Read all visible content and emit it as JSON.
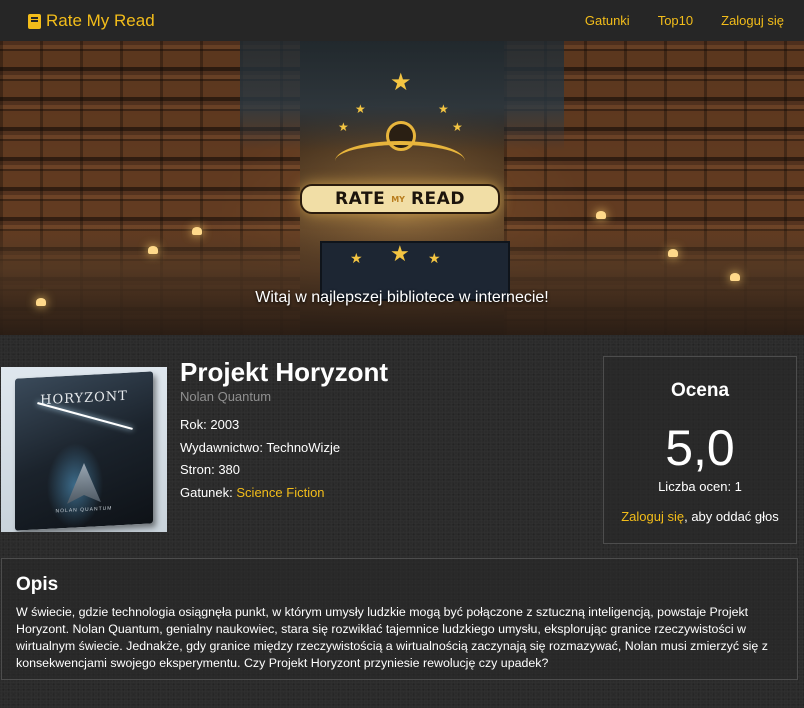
{
  "navbar": {
    "brand": "Rate My Read",
    "links": [
      "Gatunki",
      "Top10",
      "Zaloguj się"
    ]
  },
  "hero": {
    "logo_words": [
      "RATE",
      "MY",
      "READ"
    ],
    "tagline": "Witaj w najlepszej bibliotece w internecie!"
  },
  "book": {
    "cover": {
      "title": "HORYZONT",
      "author": "NOLAN QUANTUM"
    },
    "title": "Projekt Horyzont",
    "author": "Nolan Quantum",
    "year_label": "Rok:",
    "year": "2003",
    "publisher_label": "Wydawnictwo:",
    "publisher": "TechnoWizje",
    "pages_label": "Stron:",
    "pages": "380",
    "genre_label": "Gatunek:",
    "genre": "Science Fiction"
  },
  "rating": {
    "title": "Ocena",
    "value": "5,0",
    "count_text": "Liczba ocen: 1",
    "login_link": "Zaloguj się",
    "login_suffix": ", aby oddać głos"
  },
  "description": {
    "heading": "Opis",
    "text": "W świecie, gdzie technologia osiągnęła punkt, w którym umysły ludzkie mogą być połączone z sztuczną inteligencją, powstaje Projekt Horyzont. Nolan Quantum, genialny naukowiec, stara się rozwikłać tajemnice ludzkiego umysłu, eksplorując granice rzeczywistości w wirtualnym świecie. Jednakże, gdy granice między rzeczywistością a wirtualnością zaczynają się rozmazywać, Nolan musi zmierzyć się z konsekwencjami swojego eksperymentu. Czy Projekt Horyzont przyniesie rewolucję czy upadek?"
  },
  "colors": {
    "accent": "#f3bd1a",
    "navbar_bg": "#262626",
    "page_bg": "#2b2b2b",
    "muted_text": "#8f8f8f"
  },
  "icons": {
    "brand": "book-icon"
  }
}
